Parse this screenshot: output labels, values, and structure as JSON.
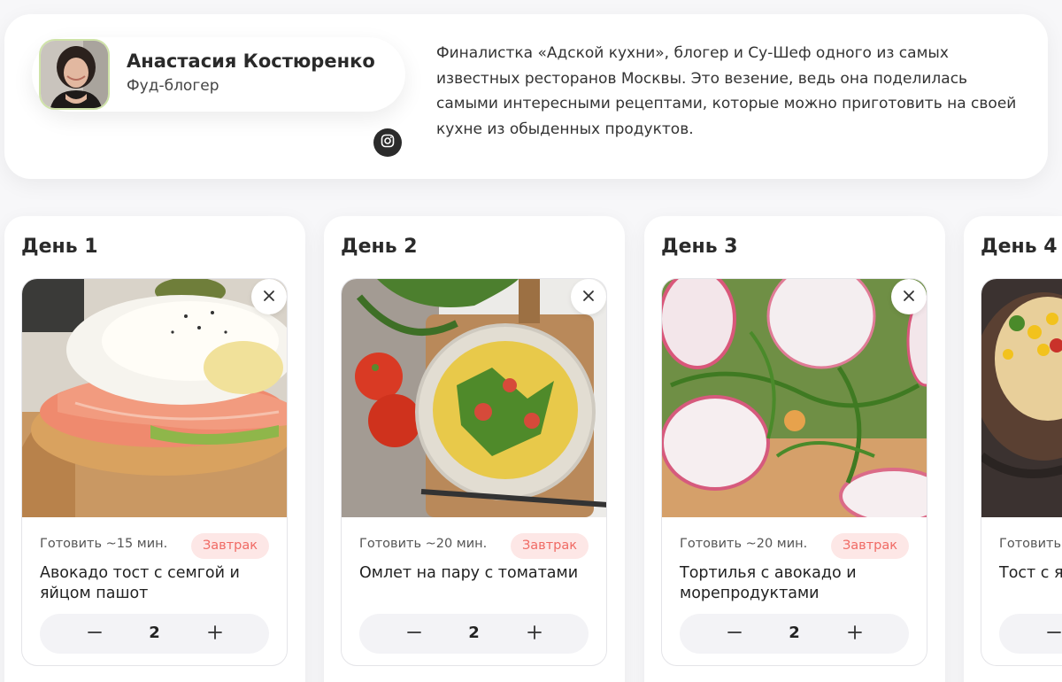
{
  "author": {
    "name": "Анастасия Костюренко",
    "role": "Фуд-блогер",
    "bio": "Финалистка «Адской кухни», блогер и Су-Шеф одного из самых известных ресторанов Москвы. Это везение, ведь она поделилась самыми интересными рецептами, которые можно приготовить на своей кухне из обыденных продуктов.",
    "social_icon": "instagram-icon"
  },
  "days": [
    {
      "title": "День 1",
      "recipe": {
        "time": "Готовить ~15 мин.",
        "meal": "Завтрак",
        "title": "Авокадо тост с семгой и яйцом пашот",
        "portions": "2"
      }
    },
    {
      "title": "День 2",
      "recipe": {
        "time": "Готовить ~20 мин.",
        "meal": "Завтрак",
        "title": "Омлет на пару с томатами",
        "portions": "2"
      }
    },
    {
      "title": "День 3",
      "recipe": {
        "time": "Готовить ~20 мин.",
        "meal": "Завтрак",
        "title": "Тортилья с авокадо и морепродуктами",
        "portions": "2"
      }
    },
    {
      "title": "День 4",
      "recipe": {
        "time": "Готовить",
        "title": "Тост с я"
      }
    }
  ],
  "colors": {
    "badge_bg": "#fde7e6",
    "badge_text": "#f06a64",
    "card_bg": "#ffffff",
    "page_bg": "#f7f7f9"
  }
}
